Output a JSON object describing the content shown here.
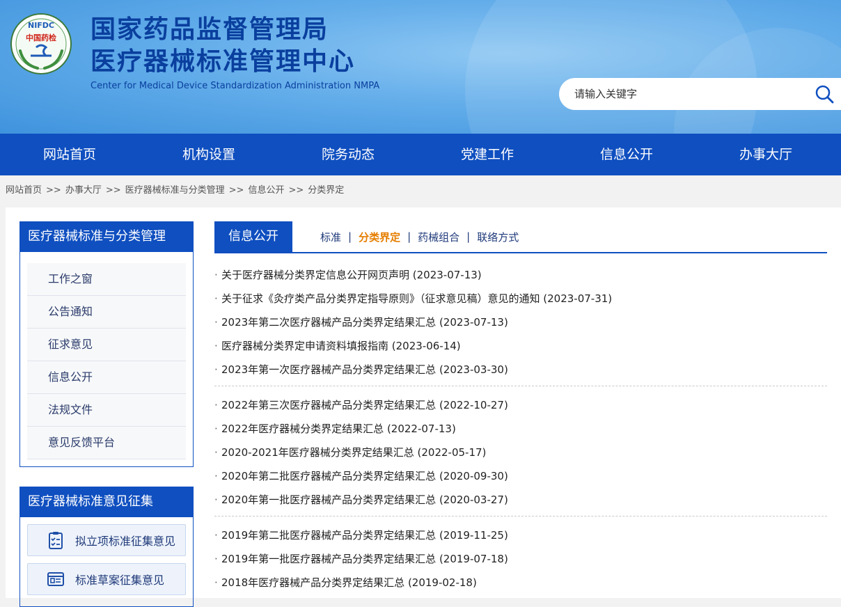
{
  "header": {
    "logo_text_top": "NIFDC",
    "logo_text_mid": "中国药检",
    "title_line1": "国家药品监督管理局",
    "title_line2": "医疗器械标准管理中心",
    "title_en": "Center for Medical Device Standardization Administration NMPA",
    "search_placeholder": "请输入关键字"
  },
  "nav": {
    "items": [
      {
        "label": "网站首页"
      },
      {
        "label": "机构设置"
      },
      {
        "label": "院务动态"
      },
      {
        "label": "党建工作"
      },
      {
        "label": "信息公开"
      },
      {
        "label": "办事大厅"
      }
    ]
  },
  "breadcrumb": {
    "sep": ">>",
    "items": [
      "网站首页",
      "办事大厅",
      "医疗器械标准与分类管理",
      "信息公开",
      "分类界定"
    ]
  },
  "sidebar": {
    "box1_title": "医疗器械标准与分类管理",
    "menu": [
      "工作之窗",
      "公告通知",
      "征求意见",
      "信息公开",
      "法规文件",
      "意见反馈平台"
    ],
    "box2_title": "医疗器械标准意见征集",
    "buttons": [
      {
        "label": "拟立项标准征集意见",
        "icon": "clipboard-checklist-icon"
      },
      {
        "label": "标准草案征集意见",
        "icon": "document-list-icon"
      }
    ]
  },
  "content": {
    "tab_active": "信息公开",
    "subtabs": [
      {
        "label": "标准",
        "active": false
      },
      {
        "label": "分类界定",
        "active": true
      },
      {
        "label": "药械组合",
        "active": false
      },
      {
        "label": "联络方式",
        "active": false
      }
    ],
    "bullet": "·",
    "groups": [
      [
        "关于医疗器械分类界定信息公开网页声明 (2023-07-13)",
        "关于征求《灸疗类产品分类界定指导原则》（征求意见稿）意见的通知 (2023-07-31)",
        "2023年第二次医疗器械产品分类界定结果汇总 (2023-07-13)",
        "医疗器械分类界定申请资料填报指南 (2023-06-14)",
        "2023年第一次医疗器械产品分类界定结果汇总 (2023-03-30)"
      ],
      [
        "2022年第三次医疗器械产品分类界定结果汇总 (2022-10-27)",
        "2022年医疗器械分类界定结果汇总 (2022-07-13)",
        "2020-2021年医疗器械分类界定结果汇总 (2022-05-17)",
        "2020年第二批医疗器械产品分类界定结果汇总 (2020-09-30)",
        "2020年第一批医疗器械产品分类界定结果汇总 (2020-03-27)"
      ],
      [
        "2019年第二批医疗器械产品分类界定结果汇总 (2019-11-25)",
        "2019年第一批医疗器械产品分类界定结果汇总 (2019-07-18)",
        "2018年医疗器械产品分类界定结果汇总 (2019-02-18)"
      ]
    ]
  },
  "colors": {
    "nav_blue": "#0f4fc0",
    "title_blue": "#0a3f9e",
    "active_orange": "#e67e00"
  }
}
